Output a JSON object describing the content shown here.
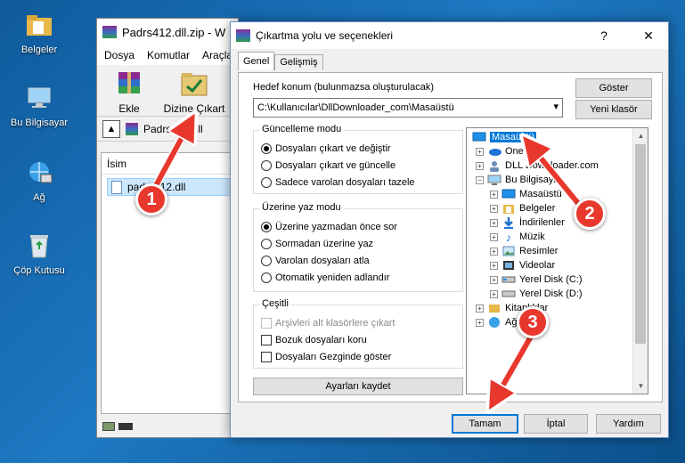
{
  "desktop": {
    "icons": [
      {
        "label": "Belgeler",
        "icon": "documents-folder-icon"
      },
      {
        "label": "Bu Bilgisayar",
        "icon": "computer-icon"
      },
      {
        "label": "Ağ",
        "icon": "network-icon"
      },
      {
        "label": "Çöp Kutusu",
        "icon": "recycle-bin-icon"
      }
    ]
  },
  "winrar": {
    "title": "Padrs412.dll.zip - W",
    "menu": [
      "Dosya",
      "Komutlar",
      "Araçla"
    ],
    "toolbar": [
      {
        "label": "Ekle",
        "icon": "add-archive-icon"
      },
      {
        "label": "Dizine Çıkart",
        "icon": "extract-to-icon"
      }
    ],
    "path": "Padrs412.dll",
    "column_header": "İsim",
    "file": "padrs412.dll"
  },
  "dialog": {
    "title": "Çıkartma yolu ve seçenekleri",
    "help": "?",
    "close": "✕",
    "tabs": [
      "Genel",
      "Gelişmiş"
    ],
    "dest_label": "Hedef konum (bulunmazsa oluşturulacak)",
    "dest_value": "C:\\Kullanıcılar\\DllDownloader_com\\Masaüstü",
    "show_button": "Göster",
    "new_folder_button": "Yeni klasör",
    "update_group": {
      "title": "Güncelleme modu",
      "options": [
        "Dosyaları çıkart ve değiştir",
        "Dosyaları çıkart ve güncelle",
        "Sadece varolan dosyaları tazele"
      ],
      "selected": 0
    },
    "overwrite_group": {
      "title": "Üzerine yaz modu",
      "options": [
        "Üzerine yazmadan önce sor",
        "Sormadan üzerine yaz",
        "Varolan dosyaları atla",
        "Otomatik yeniden adlandır"
      ],
      "selected": 0
    },
    "misc_group": {
      "title": "Çeşitli",
      "options": [
        "Arşivleri alt klasörlere çıkart",
        "Bozuk dosyaları koru",
        "Dosyaları Gezginde göster"
      ]
    },
    "save_settings": "Ayarları kaydet",
    "tree": [
      {
        "label": "Masaüstü",
        "icon": "desktop-icon",
        "selected": true
      },
      {
        "label": "OneDrive",
        "icon": "onedrive-icon"
      },
      {
        "label": "DLL Downloader.com",
        "icon": "user-icon"
      },
      {
        "label": "Bu Bilgisayar",
        "icon": "computer-icon"
      },
      {
        "label": "Masaüstü",
        "icon": "desktop-icon"
      },
      {
        "label": "Belgeler",
        "icon": "documents-icon"
      },
      {
        "label": "İndirilenler",
        "icon": "downloads-icon"
      },
      {
        "label": "Müzik",
        "icon": "music-icon"
      },
      {
        "label": "Resimler",
        "icon": "pictures-icon"
      },
      {
        "label": "Videolar",
        "icon": "videos-icon"
      },
      {
        "label": "Yerel Disk (C:)",
        "icon": "drive-icon"
      },
      {
        "label": "Yerel Disk (D:)",
        "icon": "drive-icon"
      },
      {
        "label": "Kitaplıklar",
        "icon": "libraries-icon"
      },
      {
        "label": "Ağ",
        "icon": "network-icon"
      }
    ],
    "ok_button": "Tamam",
    "cancel_button": "İptal",
    "help_button": "Yardım"
  },
  "annotations": [
    "1",
    "2",
    "3"
  ],
  "colors": {
    "accent": "#0078d7",
    "annotation": "#e8382d"
  }
}
